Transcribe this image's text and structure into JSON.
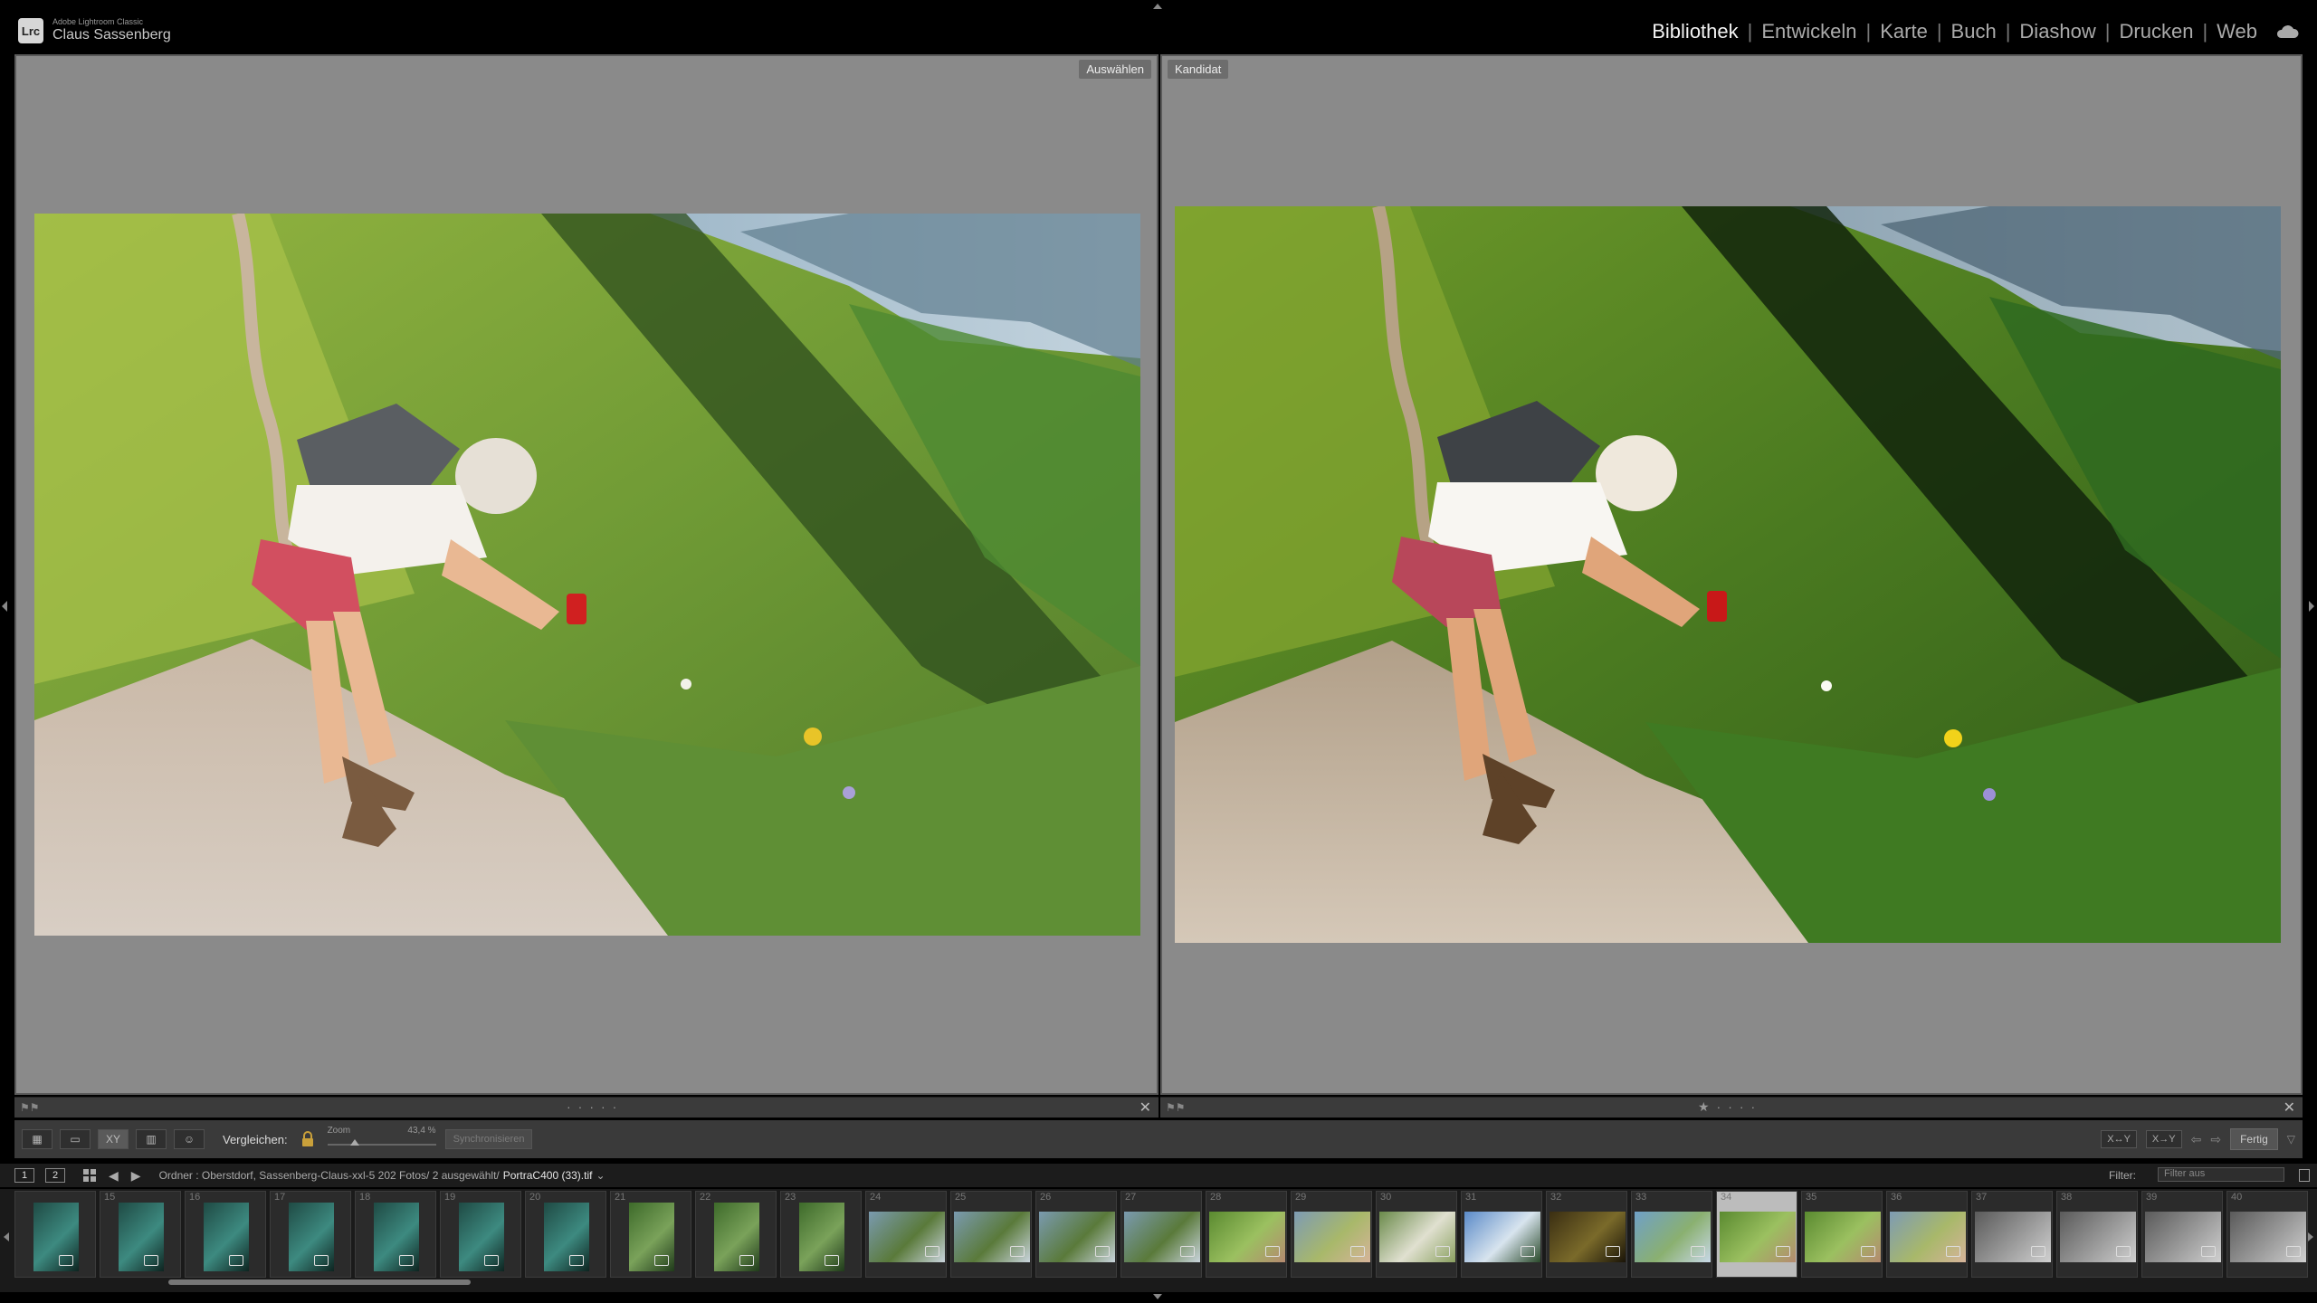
{
  "identity": {
    "app": "Adobe Lightroom Classic",
    "user": "Claus Sassenberg",
    "logo": "Lrc"
  },
  "modules": [
    {
      "label": "Bibliothek",
      "active": true
    },
    {
      "label": "Entwickeln"
    },
    {
      "label": "Karte"
    },
    {
      "label": "Buch"
    },
    {
      "label": "Diashow"
    },
    {
      "label": "Drucken"
    },
    {
      "label": "Web"
    }
  ],
  "compare": {
    "select_label": "Auswählen",
    "candidate_label": "Kandidat"
  },
  "toolbar": {
    "compare_label": "Vergleichen:",
    "zoom_label": "Zoom",
    "zoom_value": "43,4 %",
    "zoom_level": 0.25,
    "sync_label": "Synchronisieren",
    "swap_label": "X↔Y",
    "make_select_label": "X→Y",
    "done_label": "Fertig",
    "view_xy": "XY"
  },
  "film_nav": {
    "screen1": "1",
    "screen2": "2",
    "path": "Ordner : Oberstdorf, Sassenberg-Claus-xxl-5   202 Fotos/  2 ausgewählt/",
    "file": "PortraC400 (33).tif",
    "filter_label": "Filter:",
    "filter_value": "Filter aus"
  },
  "filmstrip": [
    {
      "num": "",
      "palette": "teal"
    },
    {
      "num": "15",
      "palette": "teal"
    },
    {
      "num": "16",
      "palette": "teal"
    },
    {
      "num": "17",
      "palette": "teal"
    },
    {
      "num": "18",
      "palette": "teal"
    },
    {
      "num": "19",
      "palette": "teal"
    },
    {
      "num": "20",
      "palette": "teal"
    },
    {
      "num": "21",
      "palette": "green"
    },
    {
      "num": "22",
      "palette": "green"
    },
    {
      "num": "23",
      "palette": "green"
    },
    {
      "num": "24",
      "palette": "mountain"
    },
    {
      "num": "25",
      "palette": "mountain"
    },
    {
      "num": "26",
      "palette": "mountain"
    },
    {
      "num": "27",
      "palette": "mountain"
    },
    {
      "num": "28",
      "palette": "meadow"
    },
    {
      "num": "29",
      "palette": "people"
    },
    {
      "num": "30",
      "palette": "flowers"
    },
    {
      "num": "31",
      "palette": "sky"
    },
    {
      "num": "32",
      "palette": "dark"
    },
    {
      "num": "33",
      "palette": "valley"
    },
    {
      "num": "34",
      "palette": "meadow",
      "selected": true
    },
    {
      "num": "35",
      "palette": "meadow"
    },
    {
      "num": "36",
      "palette": "people"
    },
    {
      "num": "37",
      "palette": "bw"
    },
    {
      "num": "38",
      "palette": "bw"
    },
    {
      "num": "39",
      "palette": "bw"
    },
    {
      "num": "40",
      "palette": "bw"
    }
  ]
}
